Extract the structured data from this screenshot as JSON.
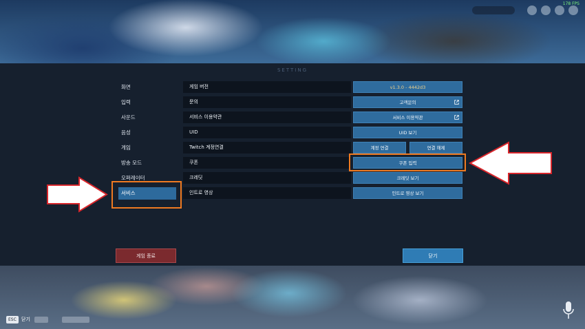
{
  "fps": "178 FPS",
  "panel_title": "SETTING",
  "menu": [
    {
      "label": "화면"
    },
    {
      "label": "입력"
    },
    {
      "label": "사운드"
    },
    {
      "label": "음성"
    },
    {
      "label": "게임"
    },
    {
      "label": "방송 모드"
    },
    {
      "label": "오퍼레이터"
    },
    {
      "label": "서비스"
    }
  ],
  "active_menu": "서비스",
  "rows": [
    {
      "label": "게임 버전",
      "value": "v1.3.0 - 4442d3"
    },
    {
      "label": "문의",
      "button": "고객문의"
    },
    {
      "label": "서비스 이용약관",
      "button": "서비스 이용약관"
    },
    {
      "label": "UID",
      "button": "UID 보기"
    },
    {
      "label": "Twitch 계정연결",
      "button_a": "계정 연결",
      "button_b": "연결 해제"
    },
    {
      "label": "쿠폰",
      "button": "쿠폰 입력"
    },
    {
      "label": "크레딧",
      "button": "크레딧 보기"
    },
    {
      "label": "인트로 영상",
      "button": "인트로 영상 보기"
    }
  ],
  "footer": {
    "quit_label": "게임 종료",
    "close_label": "닫기"
  },
  "hud": {
    "esc_key": "ESC",
    "esc_label": "닫기"
  },
  "colors": {
    "accent": "#2f6c9e",
    "highlight": "#f07a21",
    "quit": "#7b2a2e",
    "version": "#f0d28a"
  }
}
